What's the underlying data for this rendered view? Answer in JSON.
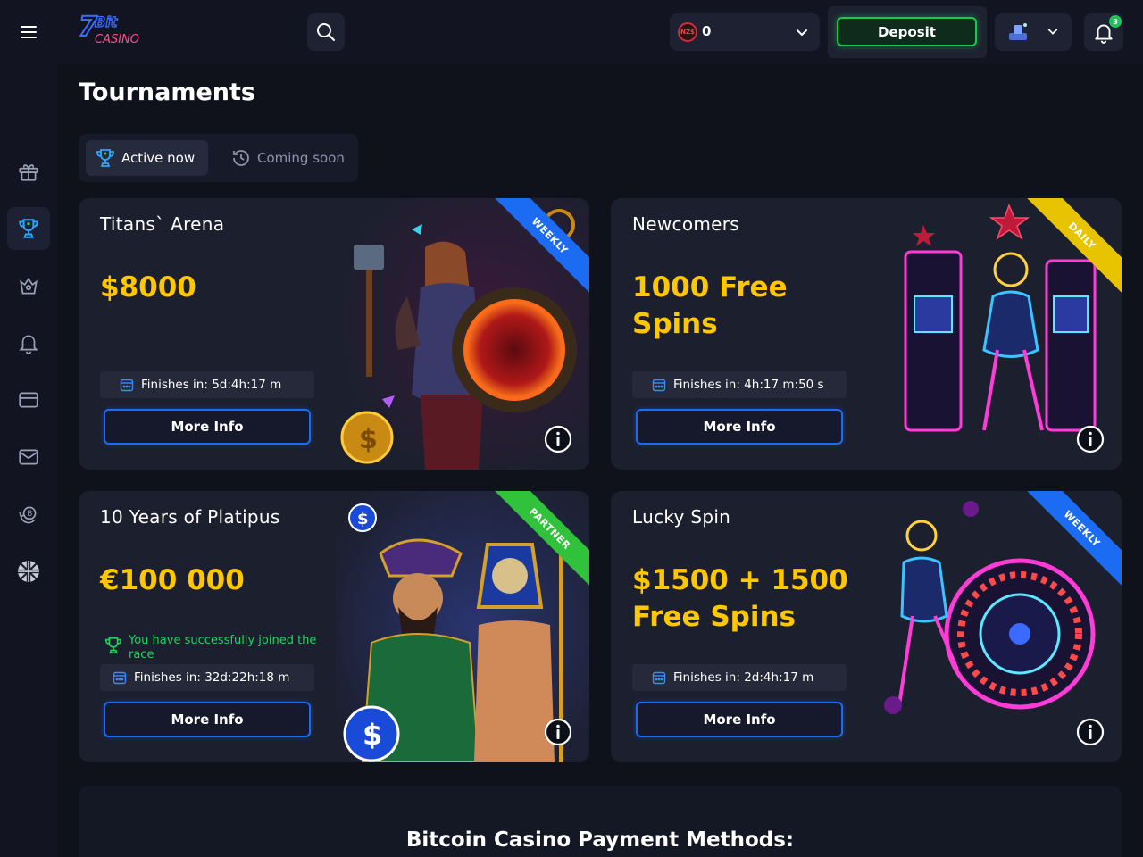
{
  "header": {
    "logo_text": "7Bit CASINO",
    "balance": {
      "currency": "NZ$",
      "amount": "0"
    },
    "deposit_label": "Deposit",
    "notification_count": "3"
  },
  "page_title": "Tournaments",
  "tabs": [
    {
      "label": "Active now",
      "active": true
    },
    {
      "label": "Coming soon",
      "active": false
    }
  ],
  "sidebar_icons": [
    "gift-icon",
    "trophy-icon",
    "crown-icon",
    "bell-icon",
    "card-icon",
    "mail-icon",
    "bitcoin-exchange-icon",
    "language-flag-icon"
  ],
  "tournaments": [
    {
      "title": "Titans` Arena",
      "prize": "$8000",
      "finish_label": "Finishes in:",
      "finish_time": "5d:4h:17 m",
      "button": "More Info",
      "ribbon": "WEEKLY",
      "ribbon_color": "#1b6cf2"
    },
    {
      "title": "Newcomers",
      "prize": "1000 Free Spins",
      "finish_label": "Finishes in:",
      "finish_time": "4h:17 m:50 s",
      "button": "More Info",
      "ribbon": "DAILY",
      "ribbon_color": "#e8c300"
    },
    {
      "title": "10 Years of Platipus",
      "prize": "€100 000",
      "joined_text": "You have successfully joined the race",
      "finish_label": "Finishes in:",
      "finish_time": "32d:22h:18 m",
      "button": "More Info",
      "ribbon": "PARTNER",
      "ribbon_color": "#2fc23a"
    },
    {
      "title": "Lucky Spin",
      "prize": "$1500 + 1500 Free Spins",
      "finish_label": "Finishes in:",
      "finish_time": "2d:4h:17 m",
      "button": "More Info",
      "ribbon": "WEEKLY",
      "ribbon_color": "#1b6cf2"
    }
  ],
  "footer_title": "Bitcoin Casino Payment Methods:"
}
